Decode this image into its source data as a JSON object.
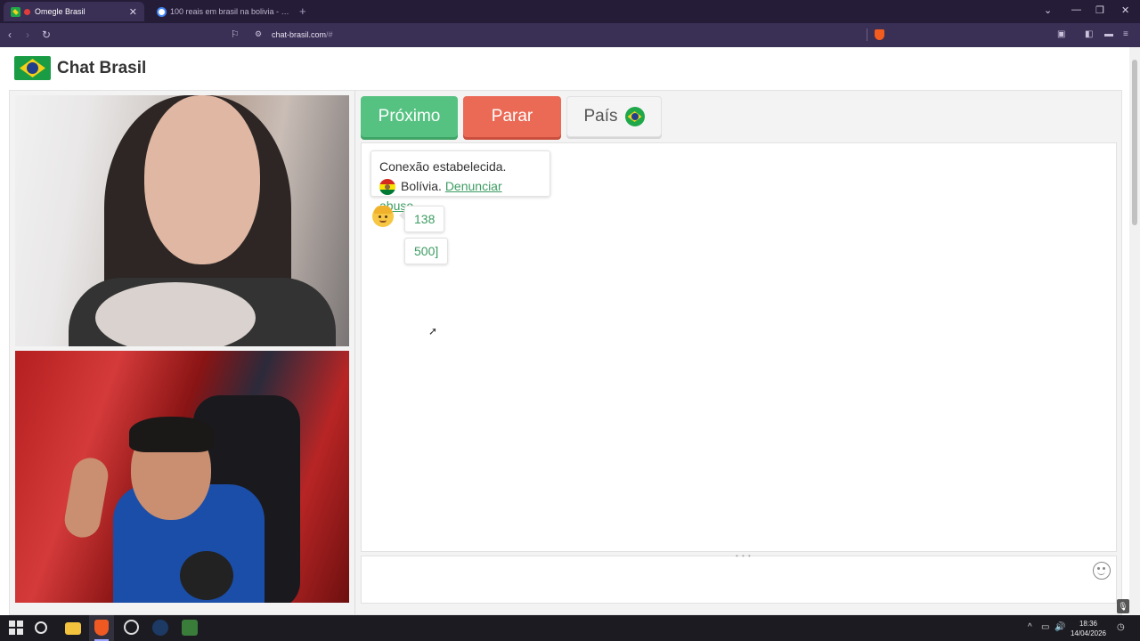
{
  "browser": {
    "tabs": [
      {
        "title": "Omegle Brasil",
        "active": true
      },
      {
        "title": "100 reais em brasil na bolivia - Pesqu",
        "active": false
      }
    ],
    "url_host": "chat-brasil.com",
    "url_path": "/#"
  },
  "site": {
    "title": "Chat Brasil"
  },
  "controls": {
    "next_label": "Próximo",
    "stop_label": "Parar",
    "country_label": "País",
    "colors": {
      "next": "#56c281",
      "stop": "#eb6a56"
    }
  },
  "chat": {
    "system_message": {
      "line1": "Conexão estabelecida.",
      "country": "Bolívia.",
      "report_link": "Denunciar abuso",
      "trailing": "."
    },
    "messages": [
      {
        "from": "stranger",
        "text": "138"
      },
      {
        "from": "stranger",
        "text": "500]"
      }
    ]
  },
  "taskbar": {
    "time": "18:36",
    "date": "14/04/2026"
  }
}
